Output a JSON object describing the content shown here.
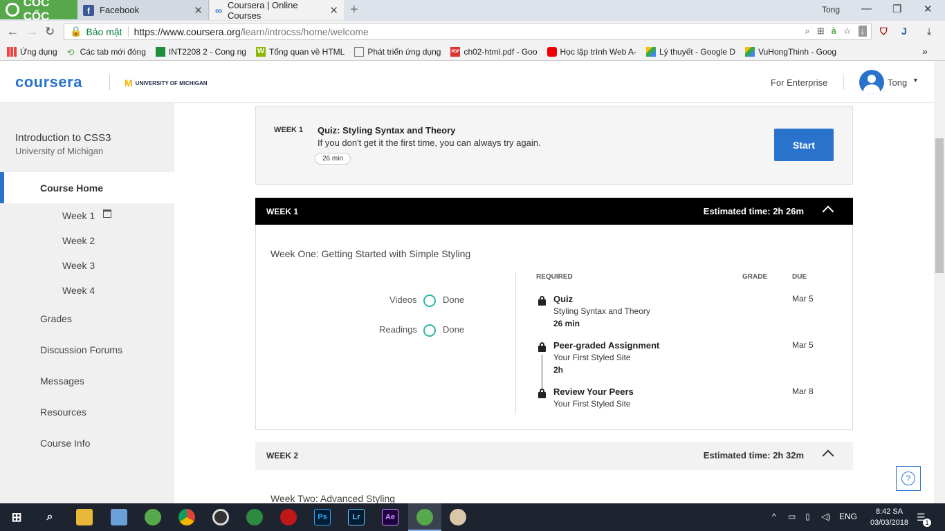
{
  "browser": {
    "brand": "CỐC CỐC",
    "tabs": [
      {
        "label": "Facebook"
      },
      {
        "label": "Coursera | Online Courses"
      }
    ],
    "window_user": "Tong",
    "secure_label": "Bảo mật",
    "url_host": "https://www.coursera.org",
    "url_path": "/learn/introcss/home/welcome",
    "bookmarks": [
      "Ứng dụng",
      "Các tab mới đóng",
      "INT2208 2 - Cong ng",
      "Tổng quan về HTML",
      "Phát triển ứng dụng",
      "ch02-html.pdf - Goo",
      "Học lập trình Web A-",
      "Lý thuyết - Google D",
      "VuHongThinh - Goog"
    ]
  },
  "header": {
    "logo": "coursera",
    "partner": "UNIVERSITY OF MICHIGAN",
    "enterprise": "For Enterprise",
    "user": "Tong"
  },
  "sidebar": {
    "course_title": "Introduction to CSS3",
    "course_university": "University of Michigan",
    "home": "Course Home",
    "weeks": [
      "Week 1",
      "Week 2",
      "Week 3",
      "Week 4"
    ],
    "links": [
      "Grades",
      "Discussion Forums",
      "Messages",
      "Resources",
      "Course Info"
    ]
  },
  "quiz_card": {
    "week": "WEEK 1",
    "title": "Quiz: Styling Syntax and Theory",
    "description": "If you don't get it the first time, you can always try again.",
    "duration": "26 min",
    "start": "Start"
  },
  "week1": {
    "label": "WEEK 1",
    "estimated": "Estimated time: 2h 26m",
    "subtitle": "Week One: Getting Started with Simple Styling",
    "progress": [
      {
        "label": "Videos",
        "status": "Done"
      },
      {
        "label": "Readings",
        "status": "Done"
      }
    ],
    "columns": {
      "required": "REQUIRED",
      "grade": "GRADE",
      "due": "DUE"
    },
    "items": [
      {
        "title": "Quiz",
        "subtitle": "Styling Syntax and Theory",
        "detail": "26 min",
        "due": "Mar 5"
      },
      {
        "title": "Peer-graded Assignment",
        "subtitle": "Your First Styled Site",
        "detail": "2h",
        "due": "Mar 5"
      },
      {
        "title": "Review Your Peers",
        "subtitle": "Your First Styled Site",
        "detail": "",
        "due": "Mar 8"
      }
    ]
  },
  "week2": {
    "label": "WEEK 2",
    "estimated": "Estimated time: 2h 32m",
    "subtitle": "Week Two: Advanced Styling"
  },
  "help_label": "?",
  "taskbar": {
    "lang": "ENG",
    "time": "8:42 SA",
    "date": "03/03/2018",
    "apps": [
      "Ps",
      "Lr",
      "Ae"
    ],
    "notifications": "1"
  }
}
